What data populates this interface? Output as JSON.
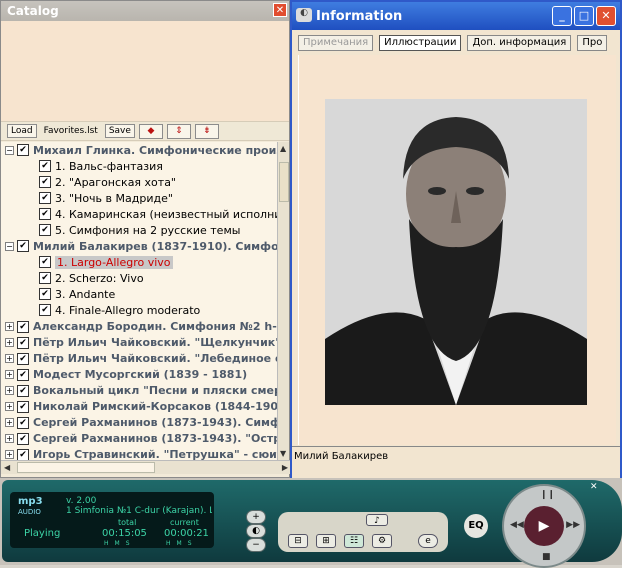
{
  "catalog": {
    "title": "Catalog",
    "close": "✕",
    "toolbar": {
      "load": "Load",
      "playlist": "Favorites.lst",
      "save": "Save",
      "icon1": "◆",
      "icon2": "⇕",
      "icon3": "⇟"
    },
    "tree": [
      {
        "type": "parent",
        "expand": "−",
        "label": "Михаил Глинка. Симфонические произве"
      },
      {
        "type": "child",
        "label": "1. Вальс-фантазия"
      },
      {
        "type": "child",
        "label": "2. \"Арагонская хота\""
      },
      {
        "type": "child",
        "label": "3. \"Ночь в Мадриде\""
      },
      {
        "type": "child",
        "label": "4. Камаринская (неизвестный исполнител"
      },
      {
        "type": "child",
        "label": "5. Симфония на 2 русские темы"
      },
      {
        "type": "parent",
        "expand": "−",
        "label": "Милий Балакирев (1837-1910). Симфония"
      },
      {
        "type": "child",
        "label": "1. Largo-Allegro vivo",
        "selected": true
      },
      {
        "type": "child",
        "label": "2. Scherzo: Vivo"
      },
      {
        "type": "child",
        "label": "3. Andante"
      },
      {
        "type": "child",
        "label": "4. Finale-Allegro moderato"
      },
      {
        "type": "parent",
        "expand": "+",
        "label": "Александр Бородин. Симфония №2 h-mo"
      },
      {
        "type": "parent",
        "expand": "+",
        "label": "Пётр Ильич Чайковский. \"Щелкунчик\", ор"
      },
      {
        "type": "parent",
        "expand": "+",
        "label": "Пётр Ильич Чайковский. \"Лебединое озер"
      },
      {
        "type": "parent",
        "expand": "+",
        "label": "Модест Мусоргский (1839 - 1881)"
      },
      {
        "type": "parent",
        "expand": "+",
        "label": "Вокальный цикл \"Песни и пляски смерти\""
      },
      {
        "type": "parent",
        "expand": "+",
        "label": "Николай Римский-Корсаков (1844-1908)"
      },
      {
        "type": "parent",
        "expand": "+",
        "label": "Сергей Рахманинов (1873-1943). Симфони"
      },
      {
        "type": "parent",
        "expand": "+",
        "label": "Сергей Рахманинов (1873-1943). \"Остров"
      },
      {
        "type": "parent",
        "expand": "+",
        "label": "Игорь Стравинский. \"Петрушка\" - сюита (1"
      }
    ]
  },
  "info": {
    "title": "Information",
    "buttons": {
      "min": "_",
      "max": "□",
      "close": "✕"
    },
    "tabs": [
      {
        "label": "Примечания",
        "state": "dim"
      },
      {
        "label": "Иллюстрации",
        "state": "active"
      },
      {
        "label": "Доп. информация",
        "state": "normal"
      },
      {
        "label": "Про",
        "state": "normal"
      }
    ],
    "caption": "Милий Балакирев"
  },
  "player": {
    "logo": "mp3",
    "logo_sub": "AUDIO",
    "version": "v. 2.00",
    "track": "1 Simfonia №1 C-dur (Karajan). Larg",
    "status": "Playing",
    "total_label": "total",
    "current_label": "current",
    "total_time": "00:15:05",
    "current_time": "00:00:21",
    "hms": "HMS",
    "eq": "EQ",
    "play": "▶"
  }
}
